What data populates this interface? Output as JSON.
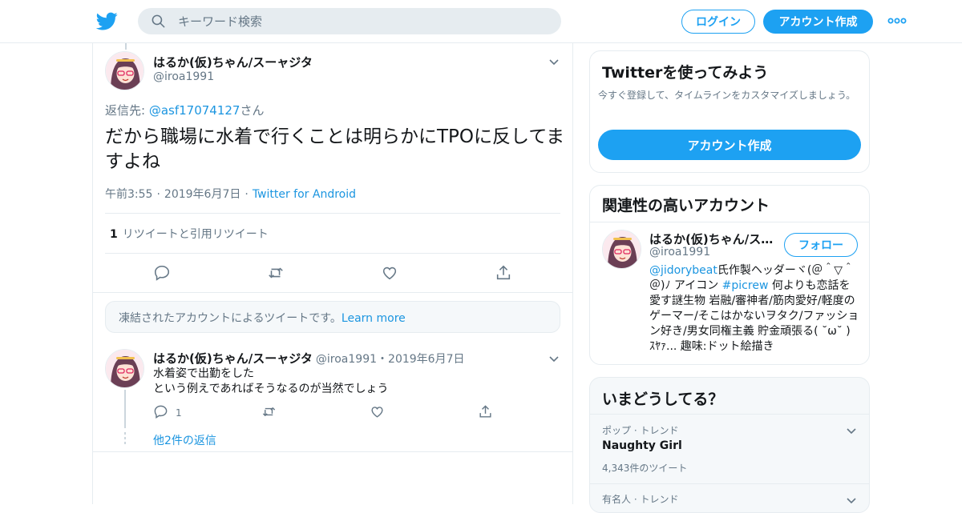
{
  "header": {
    "search_placeholder": "キーワード検索",
    "login_label": "ログイン",
    "signup_label": "アカウント作成"
  },
  "main_tweet": {
    "name": "はるか(仮)ちゃん/スーャジタ",
    "handle": "@iroa1991",
    "reply_prefix": "返信先: ",
    "reply_handle": "@asf17074127",
    "reply_suffix": "さん",
    "text": "だから職場に水着で行くことは明らかにTPOに反してますよね",
    "time": "午前3:55",
    "date": "2019年6月7日",
    "source": "Twitter for Android",
    "retweet_count": "1",
    "retweet_label": "リツイートと引用リツイート"
  },
  "suspended_notice": {
    "text": "凍結されたアカウントによるツイートです。",
    "link": "Learn more"
  },
  "reply_tweet": {
    "name": "はるか(仮)ちゃん/スーャジタ",
    "handle": "@iroa1991",
    "sep": "・",
    "date": "2019年6月7日",
    "line1": "水着姿で出勤をした",
    "line2": "という例えであればそうなるのが当然でしょう",
    "reply_count": "1",
    "more_replies": "他2件の返信"
  },
  "sidebar": {
    "signup_card": {
      "title": "Twitterを使ってみよう",
      "subtitle": "今すぐ登録して、タイムラインをカスタマイズしましょう。",
      "button": "アカウント作成"
    },
    "related": {
      "title": "関連性の高いアカウント",
      "name": "はるか(仮)ちゃん/スーャジタ",
      "handle": "@iroa1991",
      "follow": "フォロー",
      "bio_link1": "@jidorybeat",
      "bio_part1": "氏作製ヘッダーヾ(＠＾▽＾＠)ﾉ アイコン ",
      "bio_link2": "#picrew",
      "bio_part2": " 何よりも恋話を愛す謎生物 岩融/審神者/筋肉愛好/軽度のゲーマー/そこはかないヲタク/ファッション好き/男女同権主義 貯金頑張る( ˘ω˘ ) ｽﾔｧ... 趣味:ドット絵描き"
    },
    "trends": {
      "title": "いまどうしてる？",
      "items": [
        {
          "context": "ポップ · トレンド",
          "name": "Naughty Girl",
          "count": "4,343件のツイート"
        },
        {
          "context": "有名人 · トレンド",
          "name": "",
          "count": ""
        }
      ]
    }
  },
  "colors": {
    "accent": "#1da1f2",
    "link": "#1b95e0",
    "muted": "#657786",
    "border": "#e6ecf0"
  }
}
